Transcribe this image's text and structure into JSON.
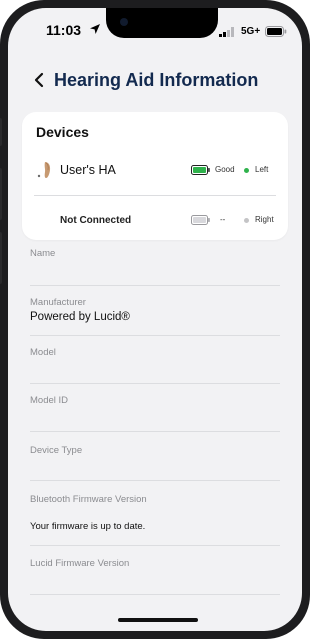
{
  "status_bar": {
    "time": "11:03",
    "network": "5G+",
    "icons": [
      "location-arrow-icon",
      "signal-bars-icon",
      "battery-icon"
    ]
  },
  "nav": {
    "back_icon": "chevron-left-icon",
    "title": "Hearing Aid Information"
  },
  "devices": {
    "heading": "Devices",
    "items": [
      {
        "name": "User's HA",
        "icon": "hearing-aid-icon",
        "battery_icon": "battery-full-icon",
        "battery_status": "Good",
        "status_color": "#2fb24c",
        "side": "Left"
      },
      {
        "name": "Not Connected",
        "battery_icon": "battery-empty-icon",
        "battery_status": "--",
        "status_color": "#c4c4c6",
        "side": "Right"
      }
    ]
  },
  "fields": [
    {
      "label": "Name",
      "value": ""
    },
    {
      "label": "Manufacturer",
      "value": "Powered by Lucid®"
    },
    {
      "label": "Model",
      "value": ""
    },
    {
      "label": "Model ID",
      "value": ""
    },
    {
      "label": "Device Type",
      "value": ""
    },
    {
      "label": "Bluetooth Firmware Version",
      "value": "Your firmware is up to date."
    },
    {
      "label": "Lucid Firmware Version",
      "value": ""
    }
  ],
  "colors": {
    "title": "#132a4f",
    "background": "#f2f2f4",
    "good_battery": "#2fb24c",
    "label": "#8b8c90"
  }
}
